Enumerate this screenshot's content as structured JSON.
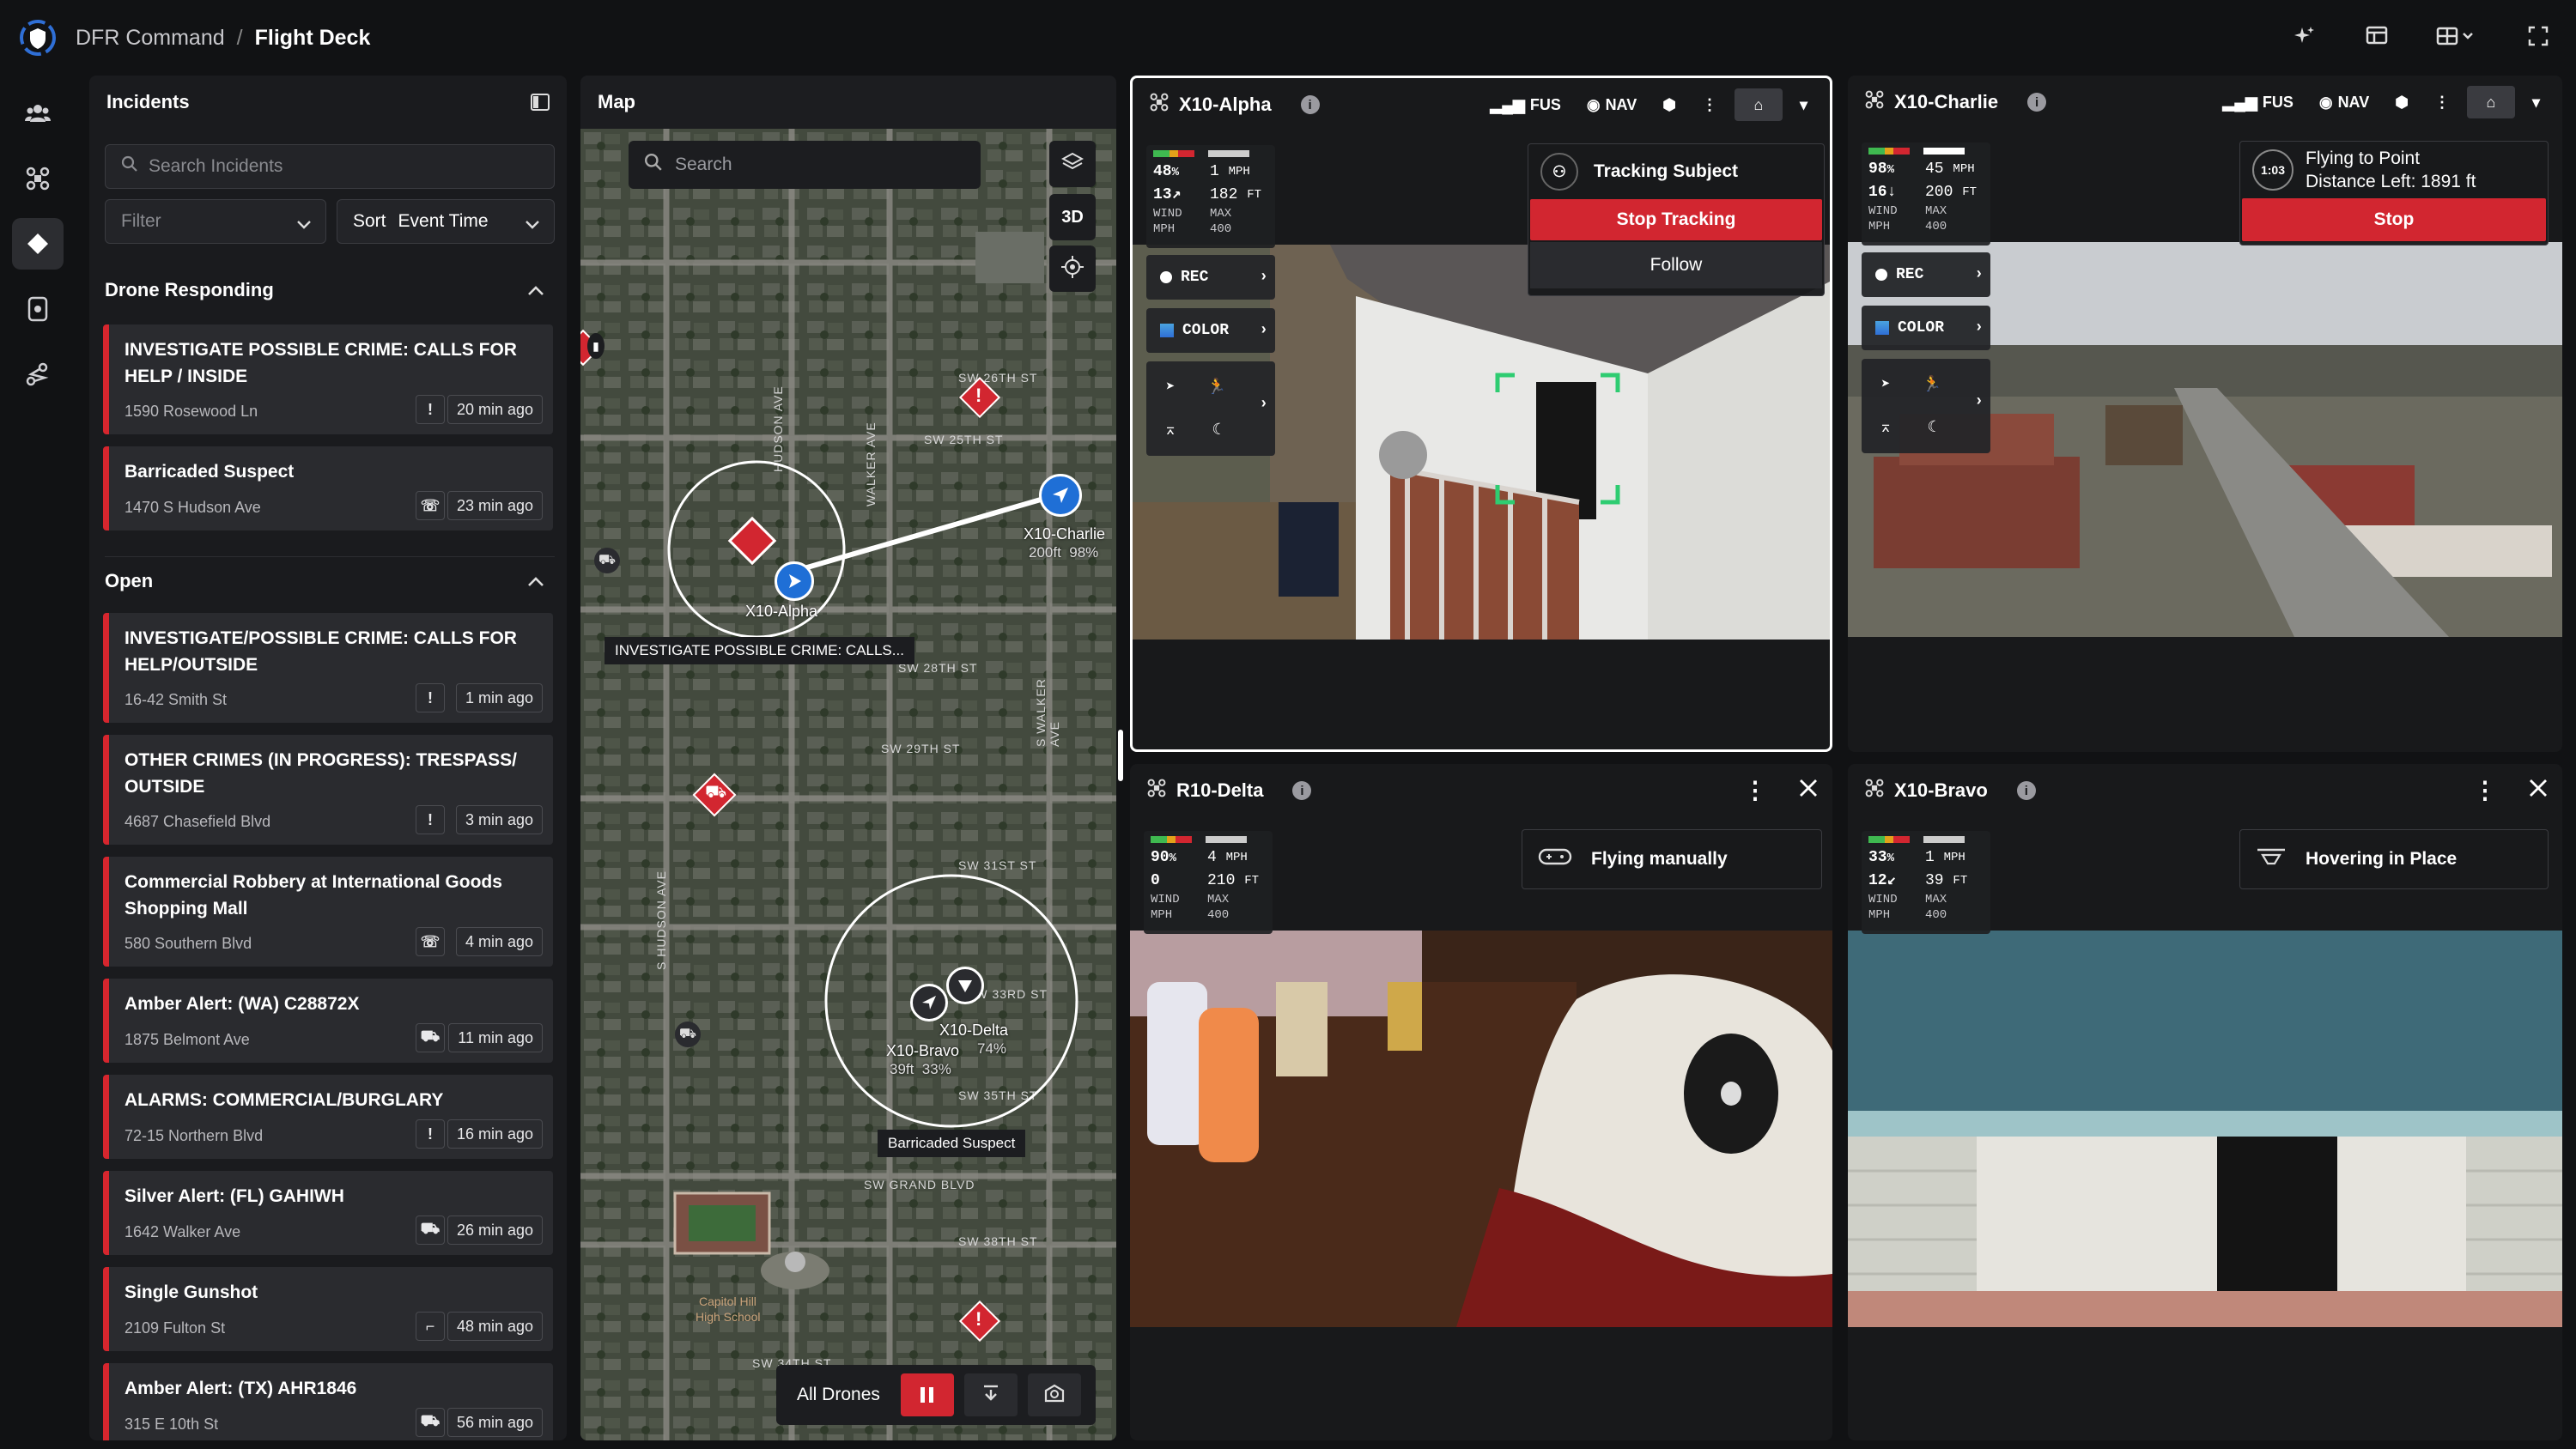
{
  "app": {
    "title": "DFR Command",
    "page": "Flight Deck"
  },
  "incidents": {
    "title": "Incidents",
    "search_placeholder": "Search Incidents",
    "filter_label": "Filter",
    "sort_label": "Sort",
    "sort_value": "Event Time",
    "sections": {
      "responding": "Drone Responding",
      "open": "Open"
    },
    "responding": [
      {
        "title": "INVESTIGATE POSSIBLE CRIME: CALLS FOR HELP / INSIDE",
        "address": "1590 Rosewood Ln",
        "time": "20 min ago",
        "icon": "exclamation-icon"
      },
      {
        "title": "Barricaded Suspect",
        "address": "1470 S Hudson Ave",
        "time": "23 min ago",
        "icon": "phone-icon"
      }
    ],
    "open": [
      {
        "title": "INVESTIGATE/POSSIBLE CRIME: CALLS FOR HELP/OUTSIDE",
        "address": "16-42 Smith St",
        "time": "1 min ago",
        "icon": "exclamation-icon"
      },
      {
        "title": "OTHER CRIMES (IN PROGRESS): TRESPASS/ OUTSIDE",
        "address": "4687 Chasefield Blvd",
        "time": "3 min ago",
        "icon": "exclamation-icon"
      },
      {
        "title": "Commercial Robbery at International Goods Shopping Mall",
        "address": "580 Southern Blvd",
        "time": "4 min ago",
        "icon": "phone-icon"
      },
      {
        "title": "Amber Alert: (WA) C28872X",
        "address": "1875 Belmont Ave",
        "time": "11 min ago",
        "icon": "car-icon"
      },
      {
        "title": "ALARMS: COMMERCIAL/BURGLARY",
        "address": "72-15 Northern Blvd",
        "time": "16 min ago",
        "icon": "exclamation-icon"
      },
      {
        "title": "Silver Alert: (FL) GAHIWH",
        "address": "1642 Walker Ave",
        "time": "26 min ago",
        "icon": "car-icon"
      },
      {
        "title": "Single Gunshot",
        "address": "2109 Fulton St",
        "time": "48 min ago",
        "icon": "gun-icon"
      },
      {
        "title": "Amber Alert: (TX) AHR1846",
        "address": "315 E 10th St",
        "time": "56 min ago",
        "icon": "car-icon"
      }
    ]
  },
  "map": {
    "title": "Map",
    "search_placeholder": "Search",
    "btn_3d": "3D",
    "drone_labels": {
      "alpha": "X10-Alpha",
      "charlie": "X10-Charlie",
      "charlie_stats": "200ft  98%",
      "bravo": "X10-Bravo",
      "bravo_stats": "39ft  33%",
      "delta": "X10-Delta",
      "delta_stats": "74%"
    },
    "callouts": {
      "alpha": "INVESTIGATE POSSIBLE CRIME: CALLS...",
      "barricaded": "Barricaded Suspect"
    },
    "streets": [
      "SW 26TH ST",
      "SW 29TH ST",
      "SW 31ST ST",
      "SW 35TH ST",
      "SW GRAND BLVD",
      "SW 38TH ST",
      "WALKER AVE",
      "HUDSON AVE",
      "S WALKER AVE",
      "S HUDSON AVE",
      "SW 25TH ST",
      "SW 28TH ST",
      "SW 33RD ST",
      "SW 34TH ST"
    ],
    "poi": [
      "Capitol Hill",
      "High School"
    ],
    "bottom": {
      "all_drones": "All Drones"
    }
  },
  "videos": {
    "alpha": {
      "name": "X10-Alpha",
      "fus": "FUS",
      "nav": "NAV",
      "battery": "48",
      "battery_unit": "%",
      "speed": "1",
      "speed_unit": "MPH",
      "wind": "13",
      "wind_dir": "↗",
      "alt": "182",
      "alt_unit": "FT",
      "wind_lbl": "WIND",
      "mph_lbl": "MPH",
      "max_lbl": "MAX",
      "max_val": "400",
      "rec": "REC",
      "color": "COLOR",
      "status": "Tracking Subject",
      "stop": "Stop Tracking",
      "follow": "Follow"
    },
    "charlie": {
      "name": "X10-Charlie",
      "fus": "FUS",
      "nav": "NAV",
      "battery": "98",
      "battery_unit": "%",
      "speed": "45",
      "speed_unit": "MPH",
      "wind": "16",
      "wind_dir": "↓",
      "alt": "200",
      "alt_unit": "FT",
      "wind_lbl": "WIND",
      "mph_lbl": "MPH",
      "max_lbl": "MAX",
      "max_val": "400",
      "rec": "REC",
      "color": "COLOR",
      "timer": "1:03",
      "status": "Flying to Point",
      "distance": "Distance Left: 1891 ft",
      "stop": "Stop"
    },
    "delta": {
      "name": "R10-Delta",
      "battery": "90",
      "battery_unit": "%",
      "speed": "4",
      "speed_unit": "MPH",
      "wind": "0",
      "alt": "210",
      "alt_unit": "FT",
      "wind_lbl": "WIND",
      "mph_lbl": "MPH",
      "max_lbl": "MAX",
      "max_val": "400",
      "status": "Flying manually"
    },
    "bravo": {
      "name": "X10-Bravo",
      "battery": "33",
      "battery_unit": "%",
      "speed": "1",
      "speed_unit": "MPH",
      "wind": "12",
      "wind_dir": "↙",
      "alt": "39",
      "alt_unit": "FT",
      "wind_lbl": "WIND",
      "mph_lbl": "MPH",
      "max_lbl": "MAX",
      "max_val": "400",
      "status": "Hovering in Place"
    }
  },
  "colors": {
    "accent_red": "#d22630",
    "drone_blue": "#1f6fd6",
    "battery_green": "#3fb950",
    "battery_amber": "#e3a21a",
    "track_green": "#2ecc71"
  }
}
